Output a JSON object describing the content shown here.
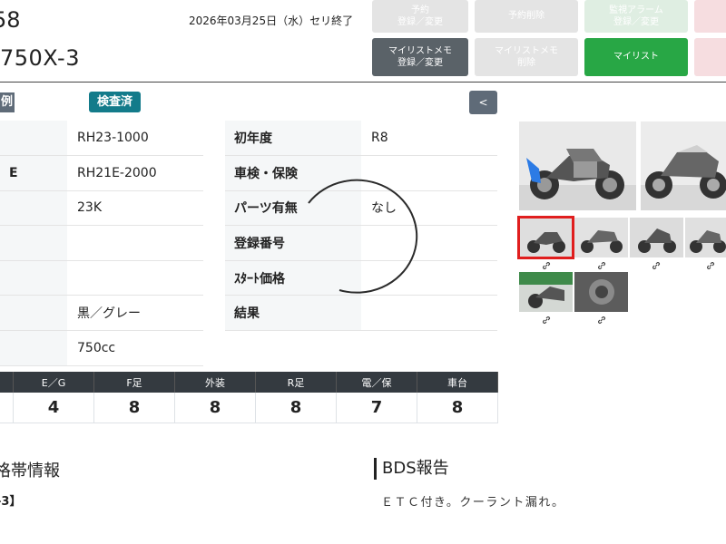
{
  "header": {
    "lot_number": "58",
    "model_name": "750X-3",
    "end_date": "2026年03月25日（水）セリ終了"
  },
  "buttons": {
    "reserve": "予約\n登録／変更",
    "reserve_delete": "予約削除",
    "alarm": "監視アラーム\n登録／変更",
    "mylist_memo": "マイリストメモ\n登録／変更",
    "mylist_memo_delete": "マイリストメモ\n削除",
    "mylist": "マイリスト",
    "collapse": "<"
  },
  "badges": {
    "left": "例",
    "inspected": "検査済"
  },
  "spec_rows": [
    {
      "left_label": "",
      "left_value": "RH23-1000",
      "right_label": "初年度",
      "right_value": "R8"
    },
    {
      "left_label": "E",
      "left_value": "RH21E-2000",
      "right_label": "車検・保険",
      "right_value": ""
    },
    {
      "left_label": "",
      "left_value": "23K",
      "right_label": "パーツ有無",
      "right_value": "なし"
    },
    {
      "left_label": "",
      "left_value": "",
      "right_label": "登録番号",
      "right_value": ""
    },
    {
      "left_label": "",
      "left_value": "",
      "right_label": "ｽﾀｰﾄ価格",
      "right_value": ""
    },
    {
      "left_label": "",
      "left_value": "黒／グレー",
      "right_label": "結果",
      "right_value": ""
    },
    {
      "left_label": "",
      "left_value": "750cc",
      "right_label": "",
      "right_value": ""
    }
  ],
  "grades": {
    "headers": [
      "",
      "E／G",
      "F足",
      "外装",
      "R足",
      "電／保",
      "車台"
    ],
    "values": [
      "",
      "4",
      "8",
      "8",
      "8",
      "7",
      "8"
    ]
  },
  "sections": {
    "price_title": "格帯情報",
    "price_line": "-3】",
    "bds_title": "BDS報告",
    "bds_text": "ＥＴＣ付き。クーラント漏れ。"
  },
  "photos": {
    "main": [
      "motorcycle-left-side-photo",
      "motorcycle-right-side-photo"
    ],
    "thumbs": [
      "thumb-1",
      "thumb-2",
      "thumb-3",
      "thumb-4",
      "thumb-5",
      "thumb-6"
    ],
    "selected_index": 0
  },
  "colors": {
    "dark_header": "#343a40",
    "badge_teal": "#137b8a",
    "green": "#28a745",
    "selected_outline": "#e01e1e"
  }
}
